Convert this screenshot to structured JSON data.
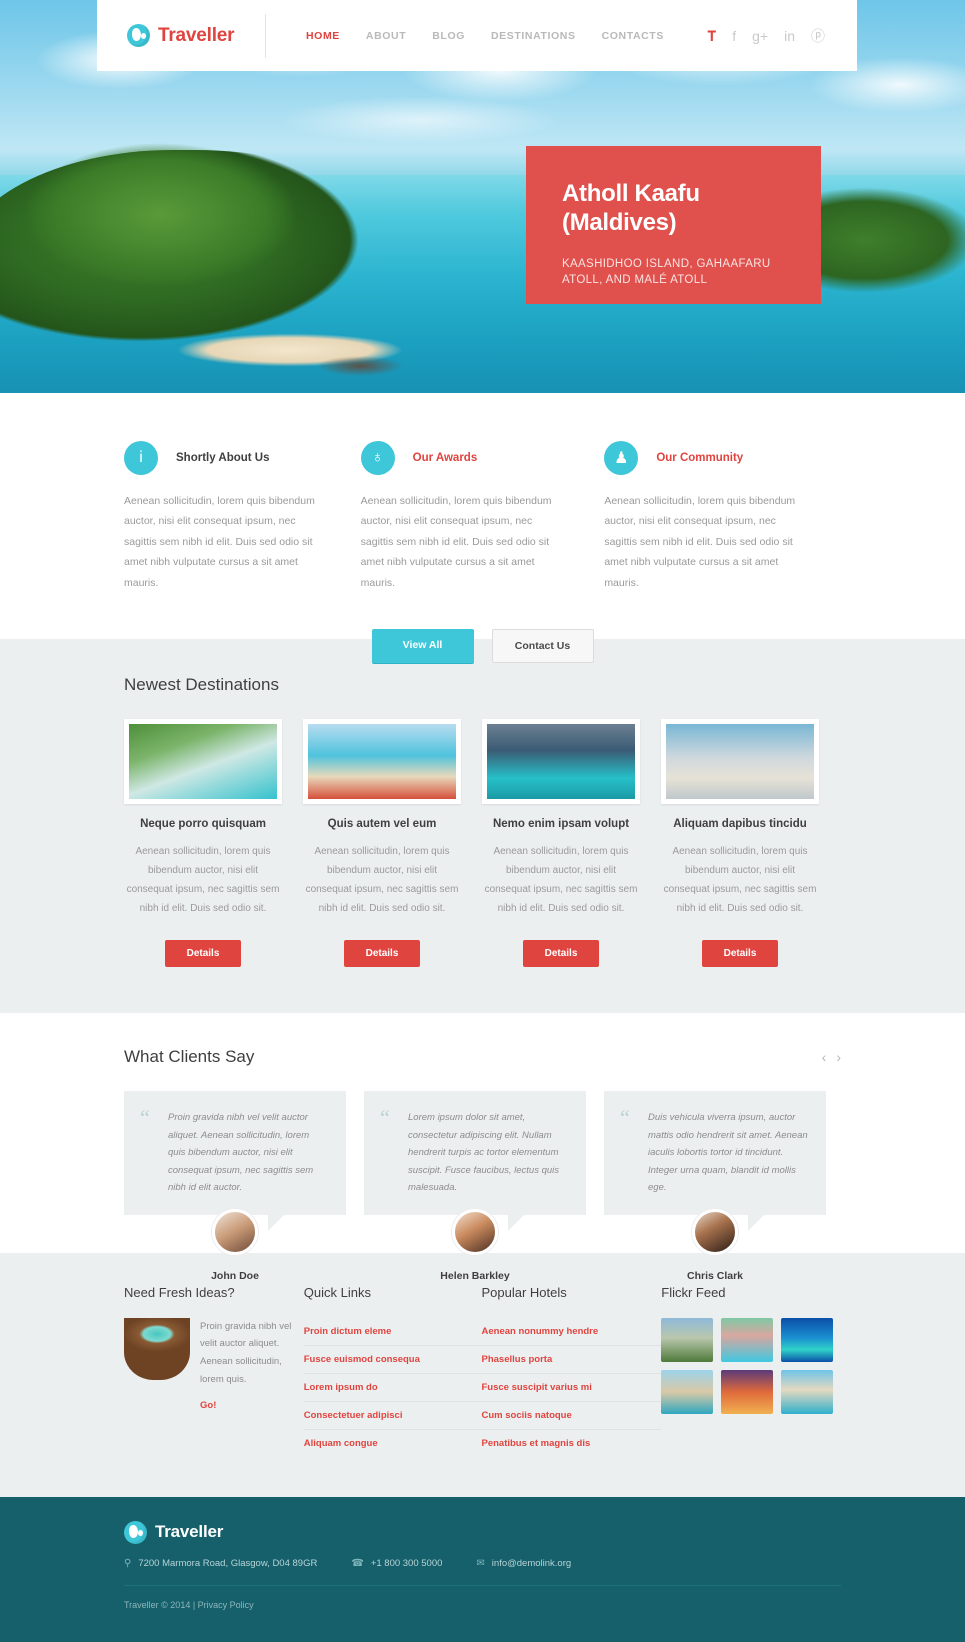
{
  "brand": {
    "name": "Traveller",
    "logo_icon": "globe-icon"
  },
  "nav": {
    "items": [
      {
        "label": "HOME",
        "active": true
      },
      {
        "label": "ABOUT",
        "active": false
      },
      {
        "label": "BLOG",
        "active": false
      },
      {
        "label": "DESTINATIONS",
        "active": false
      },
      {
        "label": "CONTACTS",
        "active": false
      }
    ]
  },
  "socials": [
    {
      "name": "twitter-icon",
      "glyph": "𝐓"
    },
    {
      "name": "facebook-icon",
      "glyph": "f"
    },
    {
      "name": "google-plus-icon",
      "glyph": "g+"
    },
    {
      "name": "linkedin-icon",
      "glyph": "in"
    },
    {
      "name": "pinterest-icon",
      "glyph": "ⓟ"
    }
  ],
  "hero": {
    "title": "Atholl Kaafu (Maldives)",
    "subtitle": "KAASHIDHOO ISLAND, GAHAAFARU ATOLL, AND MALÉ ATOLL",
    "caption_bg": "#e0504c"
  },
  "features": {
    "items": [
      {
        "icon": "info-icon",
        "glyph": "i",
        "title": "Shortly About Us",
        "title_color": "#3f3f3f",
        "text": "Aenean sollicitudin, lorem quis bibendum auctor, nisi elit consequat ipsum, nec sagittis sem nibh id elit. Duis sed odio sit amet nibh vulputate cursus a sit amet mauris."
      },
      {
        "icon": "trophy-icon",
        "glyph": "♁",
        "title": "Our Awards",
        "title_color": "#e0443f",
        "text": "Aenean sollicitudin, lorem quis bibendum auctor, nisi elit consequat ipsum, nec sagittis sem nibh id elit. Duis sed odio sit amet nibh vulputate cursus a sit amet mauris."
      },
      {
        "icon": "people-icon",
        "glyph": "♟",
        "title": "Our Community",
        "title_color": "#e0443f",
        "text": "Aenean sollicitudin, lorem quis bibendum auctor, nisi elit consequat ipsum, nec sagittis sem nibh id elit. Duis sed odio sit amet nibh vulputate cursus a sit amet mauris."
      }
    ],
    "buttons": {
      "primary": "View All",
      "secondary": "Contact Us"
    }
  },
  "destinations": {
    "title": "Newest Destinations",
    "details_label": "Details",
    "items": [
      {
        "name": "Neque porro quisquam",
        "text": "Aenean sollicitudin, lorem quis bibendum auctor, nisi elit consequat ipsum, nec sagittis sem nibh id elit. Duis sed odio sit.",
        "thumb": "waterfall-photo"
      },
      {
        "name": "Quis autem vel eum",
        "text": "Aenean sollicitudin, lorem quis bibendum auctor, nisi elit consequat ipsum, nec sagittis sem nibh id elit. Duis sed odio sit.",
        "thumb": "beach-couple-photo"
      },
      {
        "name": "Nemo enim ipsam volupt",
        "text": "Aenean sollicitudin, lorem quis bibendum auctor, nisi elit consequat ipsum, nec sagittis sem nibh id elit. Duis sed odio sit.",
        "thumb": "overwater-bungalow-photo"
      },
      {
        "name": "Aliquam dapibus tincidu",
        "text": "Aenean sollicitudin, lorem quis bibendum auctor, nisi elit consequat ipsum, nec sagittis sem nibh id elit. Duis sed odio sit.",
        "thumb": "seashell-photo"
      }
    ]
  },
  "testimonials": {
    "title": "What Clients Say",
    "prev_glyph": "‹",
    "next_glyph": "›",
    "quote_glyph": "“",
    "items": [
      {
        "text": "Proin gravida nibh vel velit auctor aliquet. Aenean sollicitudin, lorem quis bibendum auctor, nisi elit consequat ipsum, nec sagittis sem nibh id elit auctor.",
        "author": "John Doe"
      },
      {
        "text": "Lorem ipsum dolor sit amet, consectetur adipiscing elit. Nullam hendrerit turpis ac tortor elementum suscipit. Fusce faucibus, lectus quis malesuada.",
        "author": "Helen Barkley"
      },
      {
        "text": "Duis vehicula viverra ipsum, auctor mattis odio hendrerit sit amet. Aenean iaculis lobortis tortor id tincidunt. Integer urna quam, blandit id mollis ege.",
        "author": "Chris Clark"
      }
    ]
  },
  "widgets": {
    "ideas": {
      "title": "Need Fresh Ideas?",
      "image": "coconut-island-illustration",
      "text": "Proin gravida nibh vel velit auctor aliquet. Aenean sollicitudin, lorem quis.",
      "link": "Go!"
    },
    "quick_links": {
      "title": "Quick Links",
      "items": [
        "Proin dictum eleme",
        "Fusce euismod consequa",
        "Lorem ipsum do",
        "Consectetuer adipisci",
        "Aliquam congue"
      ]
    },
    "popular_hotels": {
      "title": "Popular Hotels",
      "items": [
        "Aenean nonummy hendre",
        "Phasellus porta",
        "Fusce suscipit varius mi",
        "Cum sociis natoque",
        "Penatibus et magnis dis"
      ]
    },
    "flickr": {
      "title": "Flickr Feed",
      "items": [
        "castle-garden-photo",
        "pool-villa-photo",
        "aerial-island-photo",
        "longtail-boat-photo",
        "sunset-harbour-photo",
        "beach-umbrella-photo"
      ]
    }
  },
  "footer": {
    "brand": "Traveller",
    "address": "7200  Marmora Road, Glasgow, D04 89GR",
    "phone": "+1 800 300 5000",
    "email": "info@demolink.org",
    "copyright": "Traveller © 2014  |  ",
    "privacy": "Privacy Policy",
    "icons": {
      "address": "map-pin-icon",
      "phone": "phone-icon",
      "email": "envelope-icon"
    }
  }
}
